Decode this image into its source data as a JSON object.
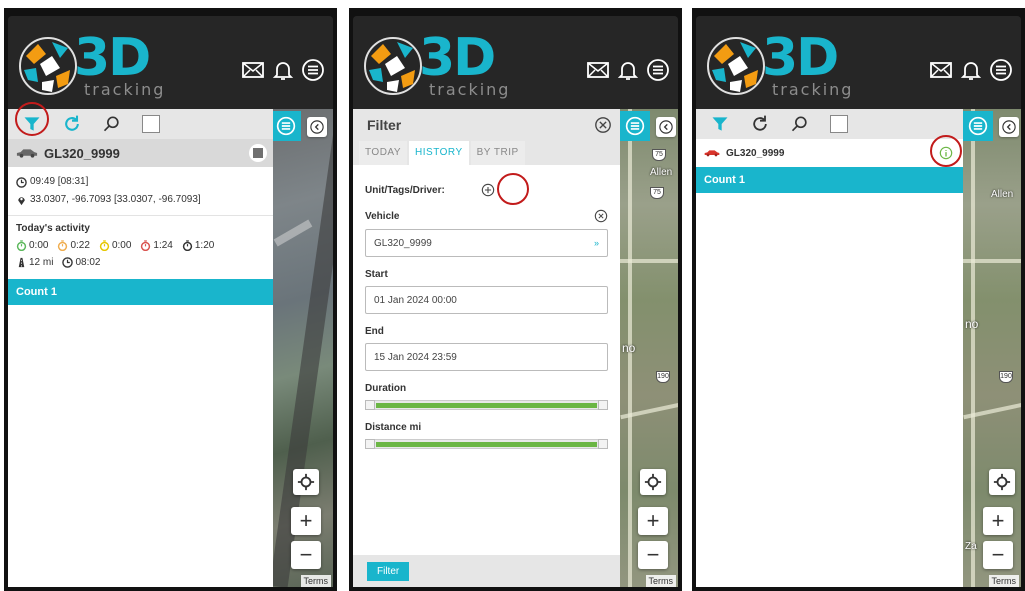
{
  "app": {
    "logo_text": "3D",
    "logo_subtext": "tracking"
  },
  "screen1": {
    "unit_name": "GL320_9999",
    "time": "09:49 [08:31]",
    "coords": "33.0307, -96.7093 [33.0307, -96.7093]",
    "activity_title": "Today's activity",
    "activity": [
      {
        "value": "0:00",
        "color": "#5cb85c"
      },
      {
        "value": "0:22",
        "color": "#f0ad4e"
      },
      {
        "value": "0:00",
        "color": "#e6c700"
      },
      {
        "value": "1:24",
        "color": "#d9534f"
      },
      {
        "value": "1:20",
        "color": "#333333"
      }
    ],
    "distance": "12 mi",
    "duration": "08:02",
    "count": "Count 1"
  },
  "screen2": {
    "title": "Filter",
    "tabs": [
      "TODAY",
      "HISTORY",
      "BY TRIP"
    ],
    "active_tab": "HISTORY",
    "unit_tags_label": "Unit/Tags/Driver:",
    "vehicle_label": "Vehicle",
    "vehicle_value": "GL320_9999",
    "start_label": "Start",
    "start_value": "01 Jan 2024 00:00",
    "end_label": "End",
    "end_value": "15 Jan 2024 23:59",
    "duration_label": "Duration",
    "distance_label": "Distance mi",
    "filter_button": "Filter"
  },
  "screen3": {
    "unit_name": "GL320_9999",
    "count": "Count 1"
  },
  "map": {
    "terms": "Terms",
    "labels": [
      "Allen",
      "Allen",
      "no",
      "no",
      "75",
      "75",
      "190",
      "190",
      "Za"
    ],
    "zoom_in": "+",
    "zoom_out": "−"
  },
  "colors": {
    "accent": "#19b5cc",
    "highlight_ring": "#c21b1b",
    "slider_fill": "#6bb644",
    "info_ring": "#6bb644"
  },
  "icons": [
    "filter-icon",
    "refresh-icon",
    "search-icon",
    "mail-icon",
    "bell-icon",
    "menu-icon",
    "chevron-left-icon",
    "locate-icon",
    "clock-icon",
    "pin-icon",
    "car-icon",
    "close-icon",
    "plus-circle-icon",
    "info-icon"
  ]
}
